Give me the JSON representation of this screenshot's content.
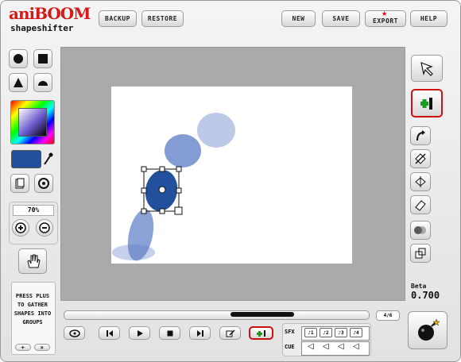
{
  "app": {
    "logo_top": "aniBOOM",
    "logo_bottom": "shapeshifter"
  },
  "topbar": {
    "backup": "BACKUP",
    "restore": "RESTORE",
    "new": "NEW",
    "save": "SAVE",
    "export": "EXPORT",
    "help": "HELP"
  },
  "colors": {
    "selected_fill": "#23509c",
    "shape_fill": "#5a7bc4",
    "canvas_bg": "#aaaaaa",
    "plus_accent": "#1f9a1f",
    "highlight_border": "#cc1111"
  },
  "left_panel": {
    "zoom": "70%",
    "hint": "PRESS PLUS TO GATHER SHAPES INTO GROUPS"
  },
  "right_panel": {
    "beta_label": "Beta",
    "version": "0.700"
  },
  "timeline": {
    "frame_counter": "4/6"
  },
  "sound": {
    "sfx_label": "SFX",
    "cue_label": "CUE"
  },
  "icons": [
    "circle-tool-icon",
    "square-tool-icon",
    "triangle-tool-icon",
    "half-circle-tool-icon",
    "eyedropper-icon",
    "page-icon",
    "rotate-icon",
    "zoom-in-icon",
    "zoom-out-icon",
    "hand-icon",
    "arrow-pointer-icon",
    "add-keyframe-icon",
    "bend-icon",
    "flip-icon",
    "transform-icon",
    "eraser-icon",
    "blur-icon",
    "layers-icon",
    "bomb-icon",
    "loop-icon",
    "step-back-icon",
    "play-icon",
    "stop-icon",
    "step-forward-icon",
    "edit-frame-icon",
    "add-frame-icon"
  ]
}
